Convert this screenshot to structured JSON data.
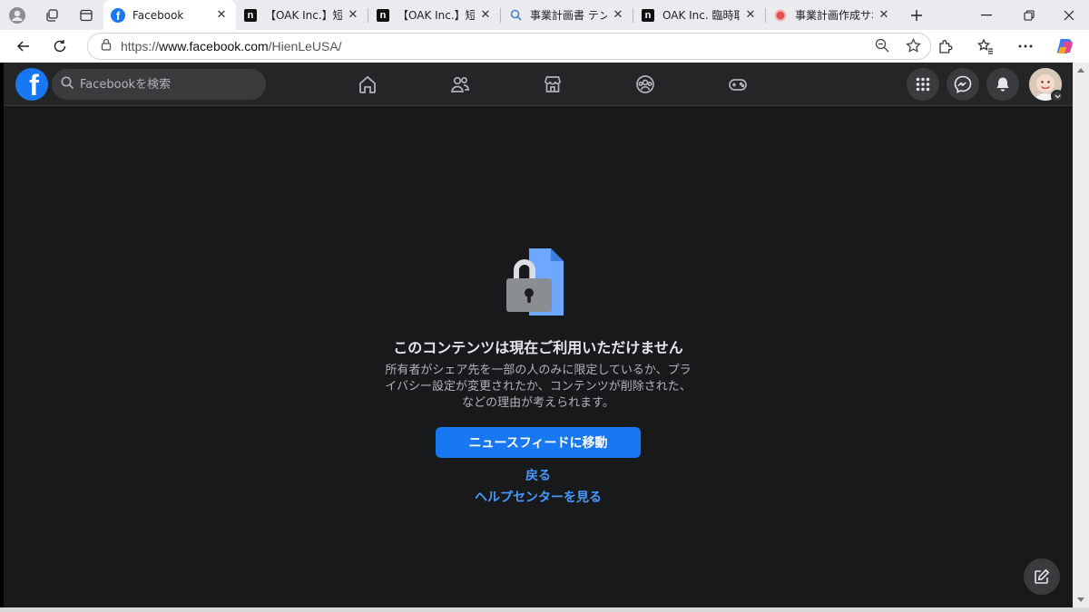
{
  "browser": {
    "tabs": [
      {
        "label": "Facebook",
        "favicon": "facebook-icon",
        "active": true
      },
      {
        "label": "【OAK Inc.】短期事",
        "favicon": "note-icon"
      },
      {
        "label": "【OAK Inc.】短期事",
        "favicon": "note-icon"
      },
      {
        "label": "事業計画書 テンプレ",
        "favicon": "search-icon"
      },
      {
        "label": "OAK Inc. 臨時取締",
        "favicon": "note-icon"
      },
      {
        "label": "事業計画作成サポ",
        "favicon": "red-dot-icon"
      }
    ],
    "url_scheme": "https://",
    "url_host": "www.facebook.com",
    "url_path": "/HienLeUSA/"
  },
  "fb": {
    "search_placeholder": "Facebookを検索",
    "nav": [
      "home-icon",
      "friends-icon",
      "marketplace-icon",
      "groups-icon",
      "gaming-icon"
    ],
    "right": [
      "menu-grid-icon",
      "messenger-icon",
      "bell-icon",
      "avatar"
    ]
  },
  "content": {
    "heading": "このコンテンツは現在ご利用いただけません",
    "desc_line1": "所有者がシェア先を一部の人のみに限定しているか、プラ",
    "desc_line2": "イバシー設定が変更されたか、コンテンツが削除された、",
    "desc_line3": "などの理由が考えられます。",
    "primary_button": "ニュースフィードに移動",
    "back_link": "戻る",
    "help_link": "ヘルプセンターを見る"
  },
  "colors": {
    "fb_blue": "#1877f2",
    "link_blue": "#4599ff",
    "bg_main": "#18191a",
    "bg_header": "#242526"
  }
}
